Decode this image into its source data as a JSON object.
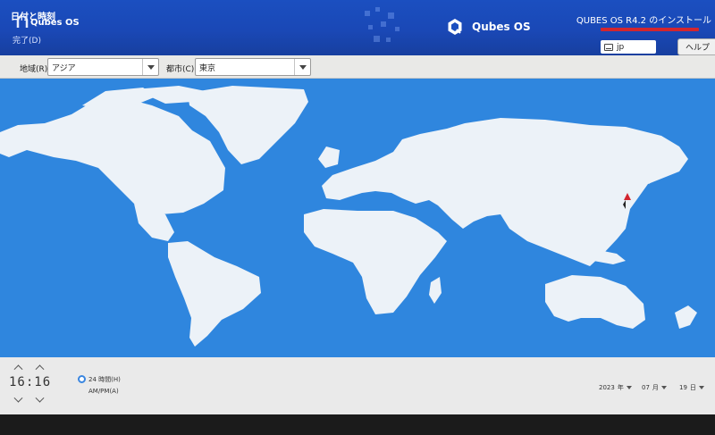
{
  "header": {
    "screen_title": "日付と時刻",
    "done_label": "完了(D)",
    "brand_small": "Qubes OS",
    "brand_center": "Qubes OS",
    "product_title": "QUBES OS R4.2 のインストール",
    "keyboard_layout": "jp",
    "help_label": "ヘルプ"
  },
  "toolbar": {
    "region_label": "地域(R):",
    "region_value": "アジア",
    "city_label": "都市(C):",
    "city_value": "東京"
  },
  "map": {
    "selected_city": "東京"
  },
  "time": {
    "hours": "16",
    "separator": ":",
    "minutes": "16",
    "format_24h_label": "24 時間(H)",
    "ampm_label": "AM/PM(A)"
  },
  "date": {
    "year": "2023",
    "year_suffix": "年",
    "month": "07",
    "month_suffix": "月",
    "day": "19",
    "day_suffix": "日"
  },
  "colors": {
    "ocean": "#2f86de",
    "land": "#ecf2f8",
    "header": "#1b4fc0",
    "pin": "#d2262f"
  }
}
